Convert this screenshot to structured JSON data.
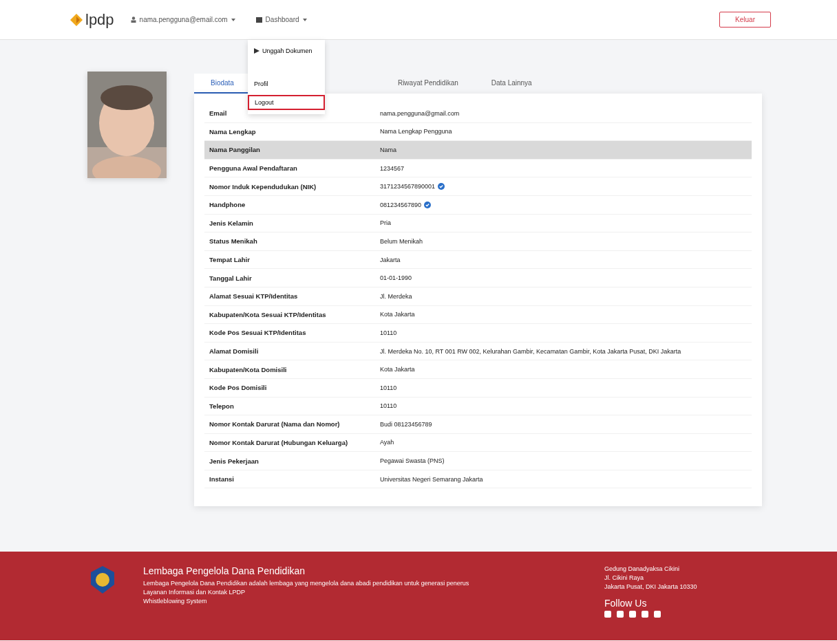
{
  "header": {
    "logo": "lpdp",
    "user_menu": "nama.pengguna@email.com",
    "dashboard_menu": "Dashboard",
    "logout_button": "Keluar"
  },
  "dropdown": {
    "items": [
      {
        "label": "Unggah Dokumen",
        "kind": "icon",
        "selected": false
      },
      {
        "label": "Profil",
        "kind": "plain",
        "selected": false
      },
      {
        "label": "Logout",
        "kind": "plain",
        "selected": true
      }
    ]
  },
  "tabs": [
    {
      "label": "Biodata",
      "selected": true
    },
    {
      "label": "Riwayat Pendidikan",
      "selected": false
    },
    {
      "label": "Data Lainnya",
      "selected": false
    }
  ],
  "rows": [
    {
      "label": "Email",
      "value": "nama.pengguna@gmail.com",
      "verified": false,
      "selected": false
    },
    {
      "label": "Nama Lengkap",
      "value": "Nama Lengkap Pengguna",
      "verified": false,
      "selected": false
    },
    {
      "label": "Nama Panggilan",
      "value": "Nama",
      "verified": false,
      "selected": true
    },
    {
      "label": "Pengguna Awal Pendaftaran",
      "value": "1234567",
      "verified": false,
      "selected": false
    },
    {
      "label": "Nomor Induk Kependudukan (NIK)",
      "value": "3171234567890001",
      "verified": true,
      "selected": false
    },
    {
      "label": "Handphone",
      "value": "081234567890",
      "verified": true,
      "selected": false
    },
    {
      "label": "Jenis Kelamin",
      "value": "Pria",
      "verified": false,
      "selected": false
    },
    {
      "label": "Status Menikah",
      "value": "Belum Menikah",
      "verified": false,
      "selected": false
    },
    {
      "label": "Tempat Lahir",
      "value": "Jakarta",
      "verified": false,
      "selected": false
    },
    {
      "label": "Tanggal Lahir",
      "value": "01-01-1990",
      "verified": false,
      "selected": false
    },
    {
      "label": "Alamat Sesuai KTP/Identitas",
      "value": "Jl. Merdeka",
      "verified": false,
      "selected": false
    },
    {
      "label": "Kabupaten/Kota Sesuai KTP/Identitas",
      "value": "Kota Jakarta",
      "verified": false,
      "selected": false
    },
    {
      "label": "Kode Pos Sesuai KTP/Identitas",
      "value": "10110",
      "verified": false,
      "selected": false
    },
    {
      "label": "Alamat Domisili",
      "value": "Jl. Merdeka No. 10, RT 001 RW 002, Kelurahan Gambir, Kecamatan Gambir, Kota Jakarta Pusat, DKI Jakarta",
      "verified": false,
      "selected": false
    },
    {
      "label": "Kabupaten/Kota Domisili",
      "value": "Kota Jakarta",
      "verified": false,
      "selected": false
    },
    {
      "label": "Kode Pos Domisili",
      "value": "10110",
      "verified": false,
      "selected": false
    },
    {
      "label": "Telepon",
      "value": "10110",
      "verified": false,
      "selected": false
    },
    {
      "label": "Nomor Kontak Darurat (Nama dan Nomor)",
      "value": "Budi 08123456789",
      "verified": false,
      "selected": false
    },
    {
      "label": "Nomor Kontak Darurat (Hubungan Keluarga)",
      "value": "Ayah",
      "verified": false,
      "selected": false
    },
    {
      "label": "Jenis Pekerjaan",
      "value": "Pegawai Swasta (PNS)",
      "verified": false,
      "selected": false
    },
    {
      "label": "Instansi",
      "value": "Universitas Negeri Semarang Jakarta",
      "verified": false,
      "selected": false
    }
  ],
  "footer": {
    "title": "Lembaga Pengelola Dana Pendidikan",
    "description": "Lembaga Pengelola Dana Pendidikan adalah lembaga yang mengelola dana abadi pendidikan untuk generasi penerus",
    "links": [
      "Layanan Informasi dan Kontak LPDP",
      "Whistleblowing System"
    ],
    "address": [
      "Gedung Danadyaksa Cikini",
      "Jl. Cikini Raya",
      "Jakarta Pusat, DKI Jakarta 10330"
    ],
    "follow": "Follow Us"
  }
}
